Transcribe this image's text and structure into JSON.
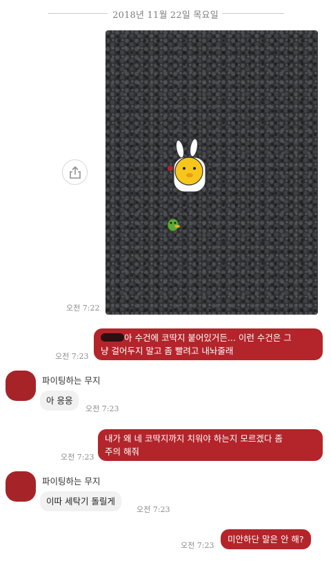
{
  "date_divider": "2018년 11월 22일 목요일",
  "photo": {
    "time": "오전 7:22",
    "share_icon": "share-icon"
  },
  "messages": [
    {
      "direction": "out",
      "text_line1": "아 수건에 코딱지 붙어있거든... 이런 수건은 그",
      "text_line2": "냥 걸어두지 말고 좀 빨려고 내놔줄래",
      "time": "오전 7:23"
    },
    {
      "direction": "in",
      "sender": "파이팅하는 무지",
      "text": "아 응응",
      "time": "오전 7:23"
    },
    {
      "direction": "out",
      "text_line1": "내가 왜 네 코딱지까지 치워야 하는지 모르겠다 좀",
      "text_line2": "주의 해줘",
      "time": "오전 7:23"
    },
    {
      "direction": "in",
      "sender": "파이팅하는 무지",
      "text": "이따 세탁기 돌릴게",
      "time": "오전 7:23"
    },
    {
      "direction": "out",
      "text": "미안하단 말은 안 해?",
      "time": "오전 7:23"
    }
  ],
  "colors": {
    "outgoing_bubble": "#b3252b",
    "incoming_bubble": "#f1f1f1",
    "avatar": "#a62428"
  }
}
